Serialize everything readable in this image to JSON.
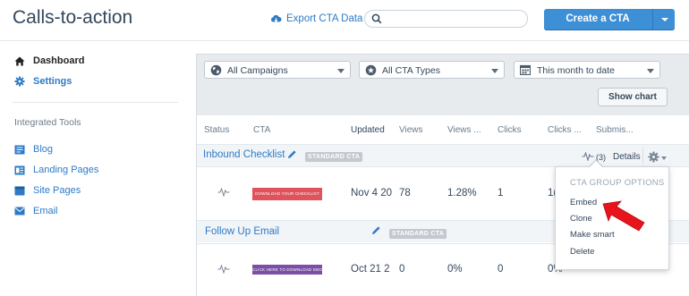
{
  "header": {
    "title": "Calls-to-action",
    "export_label": "Export CTA Data",
    "search_placeholder": "",
    "create_label": "Create a CTA"
  },
  "sidebar": {
    "nav": [
      {
        "label": "Dashboard",
        "icon": "home-icon"
      },
      {
        "label": "Settings",
        "icon": "gear-icon"
      }
    ],
    "tools_heading": "Integrated Tools",
    "tools": [
      {
        "label": "Blog",
        "icon": "blog-icon"
      },
      {
        "label": "Landing Pages",
        "icon": "landing-pages-icon"
      },
      {
        "label": "Site Pages",
        "icon": "site-pages-icon"
      },
      {
        "label": "Email",
        "icon": "email-icon"
      }
    ]
  },
  "filters": {
    "campaigns": "All Campaigns",
    "cta_types": "All CTA Types",
    "date_range": "This month to date",
    "show_chart": "Show chart"
  },
  "table": {
    "columns": [
      "Status",
      "CTA",
      "Updated",
      "Views",
      "Views ...",
      "Clicks",
      "Clicks ...",
      "Submis..."
    ],
    "groups": [
      {
        "name": "Inbound Checklist",
        "badge": "STANDARD CTA",
        "count": "(3)",
        "details": "Details",
        "row": {
          "thumb_text": "DOWNLOAD YOUR CHECKLIST",
          "thumb_color": "#e0535d",
          "updated": "Nov 4 20",
          "views": "78",
          "views_rate": "1.28%",
          "clicks": "1",
          "clicks_rate": "1("
        }
      },
      {
        "name": "Follow Up Email",
        "badge": "STANDARD CTA",
        "row": {
          "thumb_text": "CLICK HERE TO DOWNLOAD EBOOK",
          "thumb_color": "#7b4fa6",
          "updated": "Oct 21 2",
          "views": "0",
          "views_rate": "0%",
          "clicks": "0",
          "clicks_rate": "0%"
        }
      }
    ]
  },
  "group_options": {
    "heading": "CTA GROUP OPTIONS",
    "items": [
      "Embed",
      "Clone",
      "Make smart",
      "Delete"
    ]
  },
  "colors": {
    "accent": "#2d7bc6",
    "primary_button": "#3d8fd6",
    "arrow": "#e8141c"
  }
}
